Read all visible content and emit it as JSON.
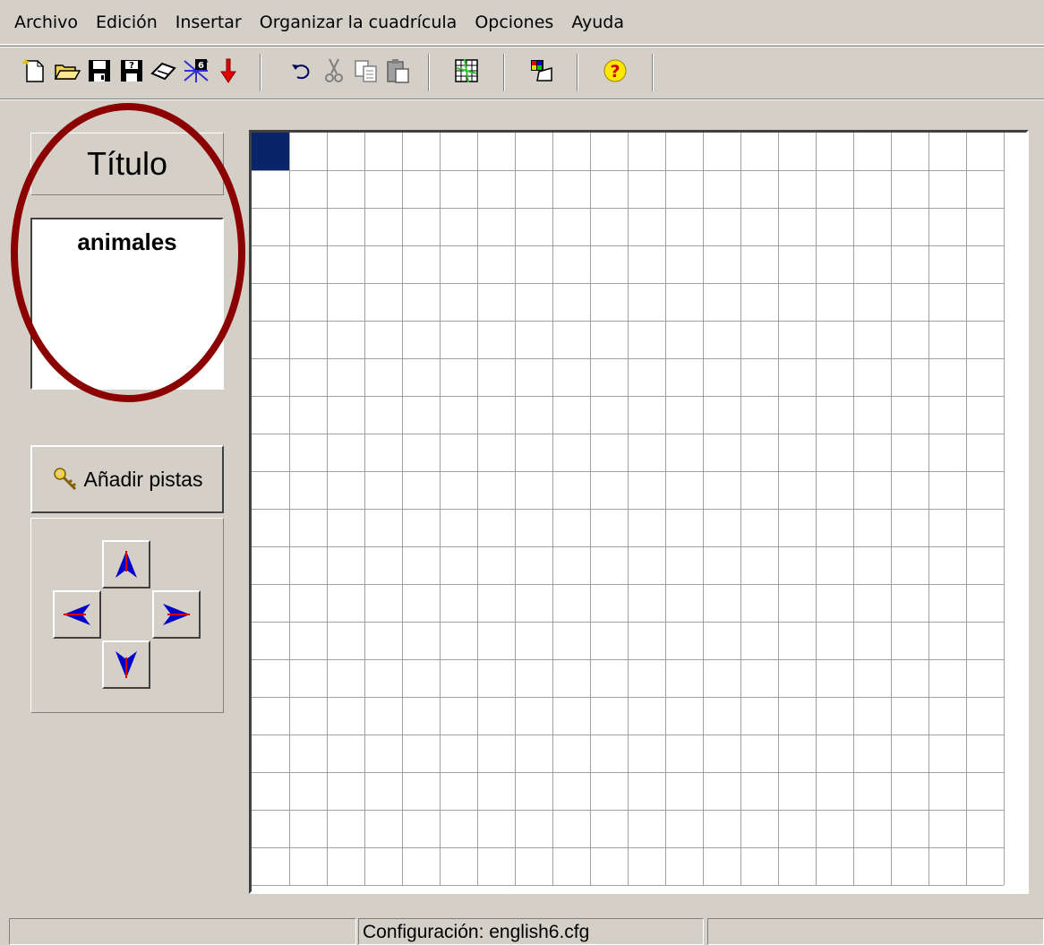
{
  "menu": [
    "Archivo",
    "Edición",
    "Insertar",
    "Organizar la cuadrícula",
    "Opciones",
    "Ayuda"
  ],
  "toolbar": {
    "icons": [
      "new-icon",
      "open-icon",
      "save-icon",
      "save-as-icon",
      "erase-icon",
      "export-icon",
      "insert-icon",
      "undo-icon",
      "cut-icon",
      "copy-icon",
      "paste-icon",
      "grid-icon",
      "palette-icon",
      "help-icon"
    ]
  },
  "title_panel": {
    "header": "Título",
    "value": "animales"
  },
  "clues_button": {
    "label": "Añadir pistas",
    "icon": "key-icon"
  },
  "arrows": [
    "up-arrow-icon",
    "left-arrow-icon",
    "right-arrow-icon",
    "down-arrow-icon"
  ],
  "grid": {
    "columns": 20,
    "rows": 20,
    "selected_cell": [
      0,
      0
    ],
    "selected_color": "#0a246a"
  },
  "status": {
    "left": "",
    "middle": "Configuración: english6.cfg",
    "right": ""
  },
  "colors": {
    "highlight": "#8b0000",
    "arrow_blue": "#0000c8",
    "arrow_red": "#d00000"
  }
}
